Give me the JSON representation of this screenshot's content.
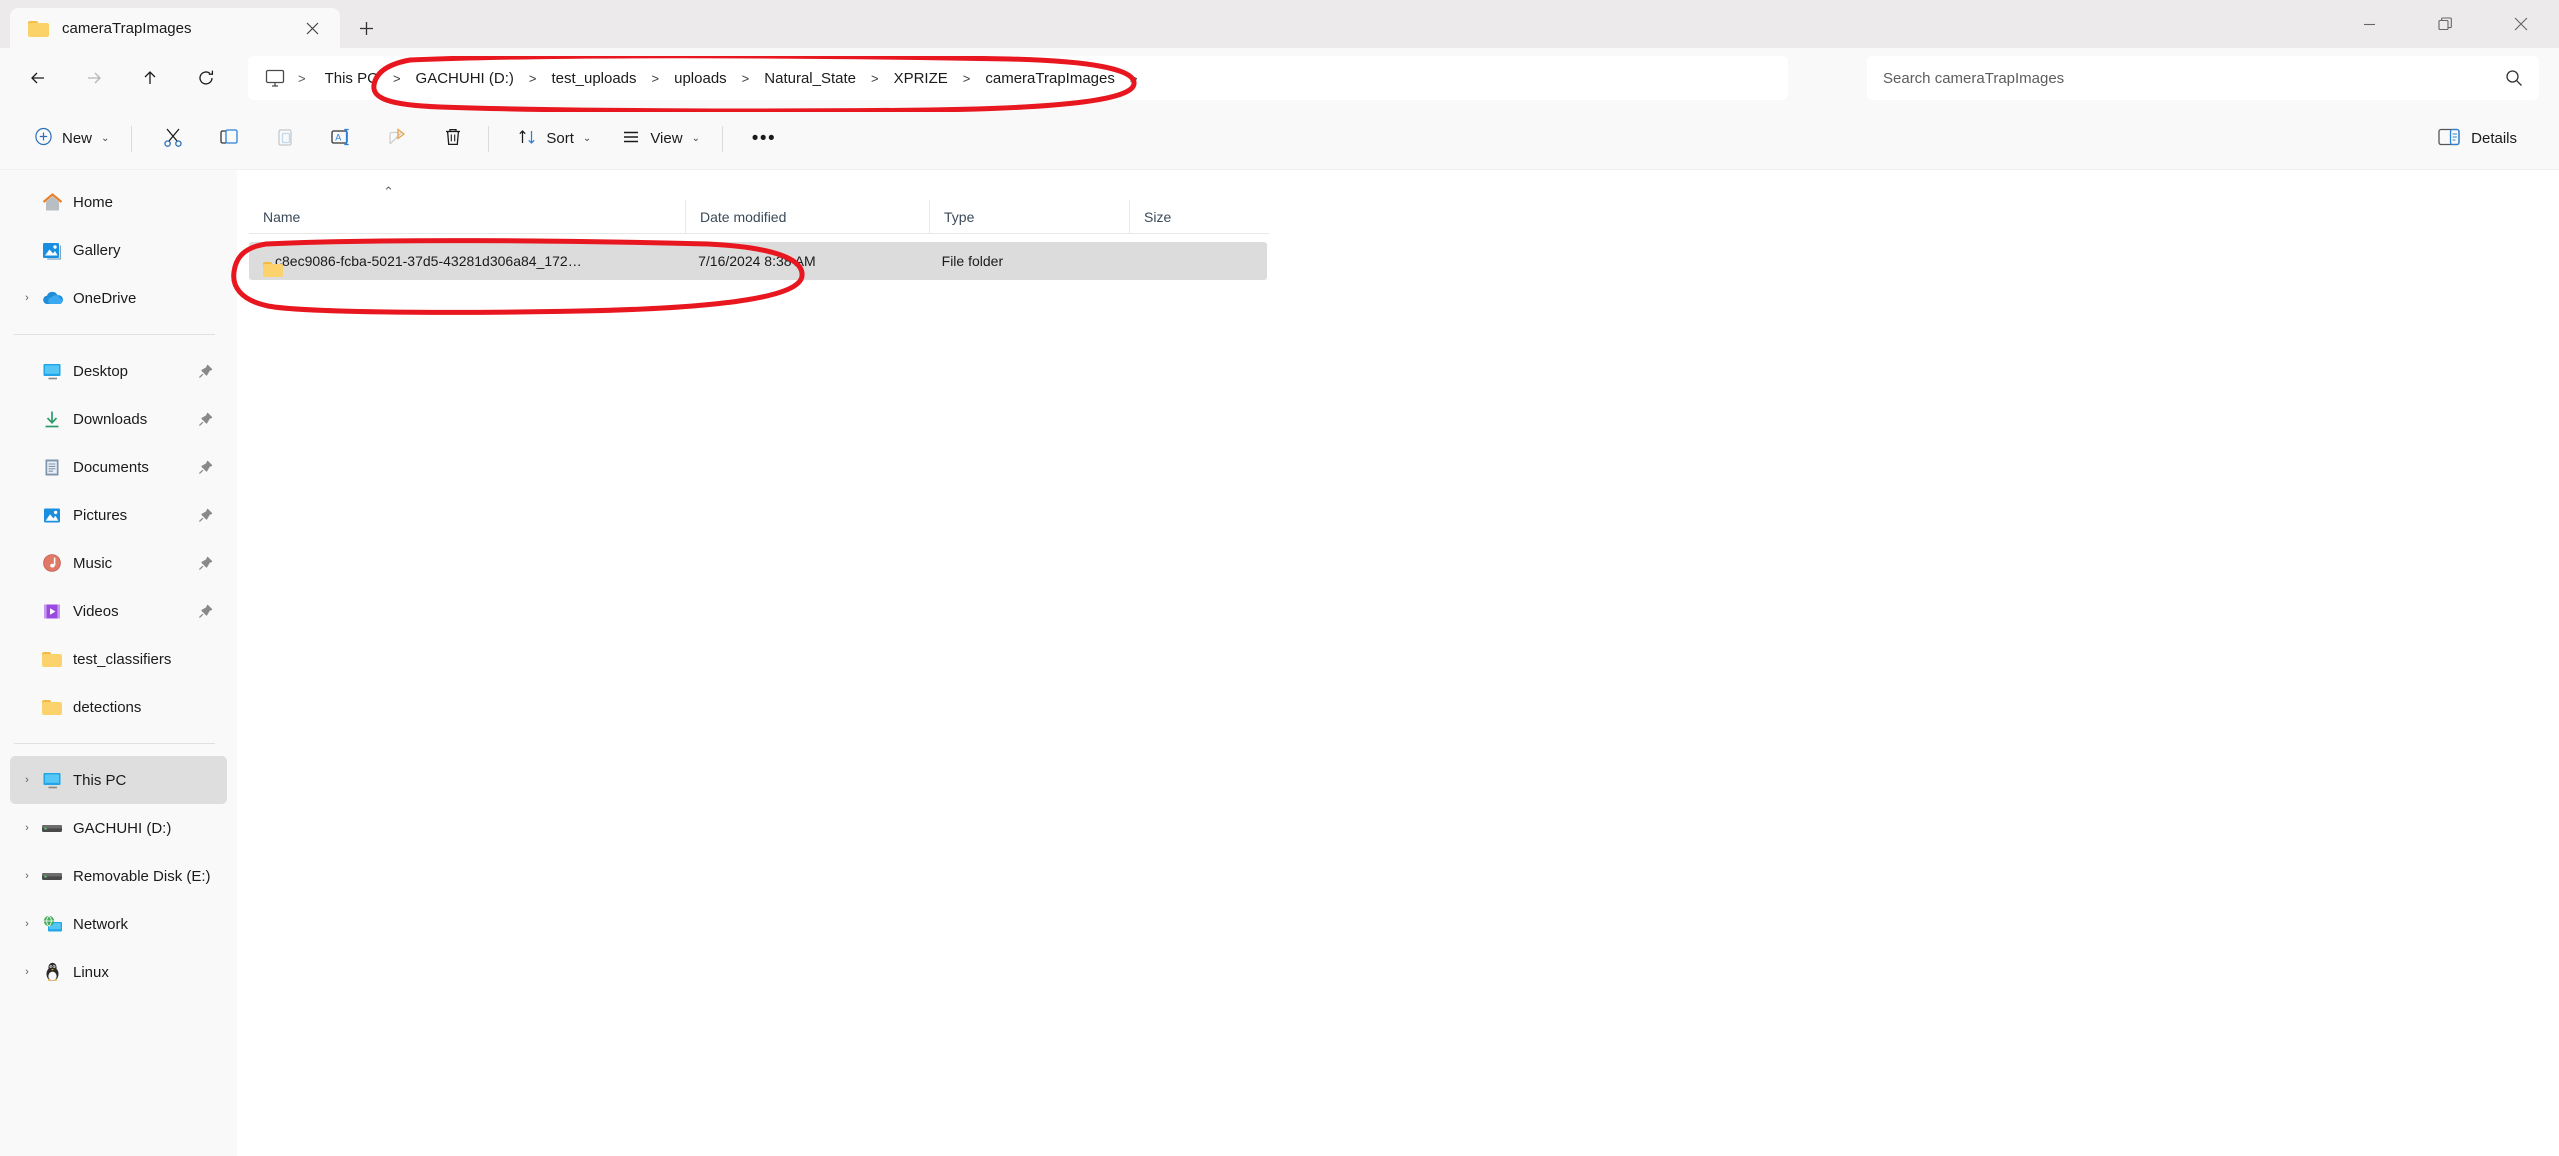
{
  "window": {
    "tab_title": "cameraTrapImages",
    "tab_close_icon": "close-icon",
    "new_tab_icon": "plus-icon",
    "minimize_icon": "minimize-icon",
    "maximize_icon": "restore-icon",
    "close_icon": "close-icon"
  },
  "nav": {
    "back": "back-arrow-icon",
    "forward": "forward-arrow-icon",
    "up": "up-arrow-icon",
    "refresh": "refresh-icon",
    "pc_icon": "monitor-icon",
    "leading_separator": ">"
  },
  "breadcrumb": {
    "separator": ">",
    "items": [
      {
        "label": "This PC"
      },
      {
        "label": "GACHUHI (D:)"
      },
      {
        "label": "test_uploads"
      },
      {
        "label": "uploads"
      },
      {
        "label": "Natural_State"
      },
      {
        "label": "XPRIZE"
      },
      {
        "label": "cameraTrapImages"
      }
    ]
  },
  "search": {
    "placeholder": "Search cameraTrapImages",
    "value": "",
    "icon": "search-icon"
  },
  "toolbar": {
    "new_label": "New",
    "new_icon": "plus-circle-icon",
    "cut_icon": "scissors-icon",
    "copy_icon": "copy-icon",
    "paste_icon": "paste-icon",
    "rename_icon": "rename-icon",
    "share_icon": "share-icon",
    "delete_icon": "trash-icon",
    "sort_label": "Sort",
    "sort_icon": "sort-icon",
    "view_label": "View",
    "view_icon": "list-icon",
    "more_label": "•••",
    "details_label": "Details",
    "details_icon": "details-pane-icon",
    "chevron": "⌄"
  },
  "sidebar": {
    "items": [
      {
        "label": "Home",
        "icon": "home-icon",
        "chevron": false,
        "pinned": false,
        "selected": false
      },
      {
        "label": "Gallery",
        "icon": "gallery-icon",
        "chevron": false,
        "pinned": false,
        "selected": false
      },
      {
        "label": "OneDrive",
        "icon": "onedrive-cloud-icon",
        "chevron": true,
        "pinned": false,
        "selected": false
      },
      {
        "divider": true
      },
      {
        "label": "Desktop",
        "icon": "desktop-icon",
        "chevron": false,
        "pinned": true,
        "selected": false
      },
      {
        "label": "Downloads",
        "icon": "downloads-icon",
        "chevron": false,
        "pinned": true,
        "selected": false
      },
      {
        "label": "Documents",
        "icon": "documents-icon",
        "chevron": false,
        "pinned": true,
        "selected": false
      },
      {
        "label": "Pictures",
        "icon": "pictures-icon",
        "chevron": false,
        "pinned": true,
        "selected": false
      },
      {
        "label": "Music",
        "icon": "music-icon",
        "chevron": false,
        "pinned": true,
        "selected": false
      },
      {
        "label": "Videos",
        "icon": "videos-icon",
        "chevron": false,
        "pinned": true,
        "selected": false
      },
      {
        "label": "test_classifiers",
        "icon": "folder-icon",
        "chevron": false,
        "pinned": false,
        "selected": false
      },
      {
        "label": "detections",
        "icon": "folder-icon",
        "chevron": false,
        "pinned": false,
        "selected": false
      },
      {
        "divider": true
      },
      {
        "label": "This PC",
        "icon": "this-pc-icon",
        "chevron": true,
        "pinned": false,
        "selected": true
      },
      {
        "label": "GACHUHI (D:)",
        "icon": "drive-icon",
        "chevron": true,
        "pinned": false,
        "selected": false
      },
      {
        "label": "Removable Disk (E:)",
        "icon": "drive-icon",
        "chevron": true,
        "pinned": false,
        "selected": false
      },
      {
        "label": "Network",
        "icon": "network-icon",
        "chevron": true,
        "pinned": false,
        "selected": false
      },
      {
        "label": "Linux",
        "icon": "linux-penguin-icon",
        "chevron": true,
        "pinned": false,
        "selected": false
      }
    ]
  },
  "filelist": {
    "columns": [
      {
        "label": "Name",
        "sorted": "asc"
      },
      {
        "label": "Date modified"
      },
      {
        "label": "Type"
      },
      {
        "label": "Size"
      }
    ],
    "sort_indicator": "⌃",
    "rows": [
      {
        "name": "c8ec9086-fcba-5021-37d5-43281d306a84_172…",
        "date_modified": "7/16/2024 8:38 AM",
        "type": "File folder",
        "size": "",
        "icon": "folder-icon",
        "selected": true
      }
    ]
  },
  "annotations": {
    "color": "#e8171f",
    "shapes": [
      {
        "name": "breadcrumb-highlight-oval"
      },
      {
        "name": "selected-row-highlight-oval"
      }
    ]
  }
}
